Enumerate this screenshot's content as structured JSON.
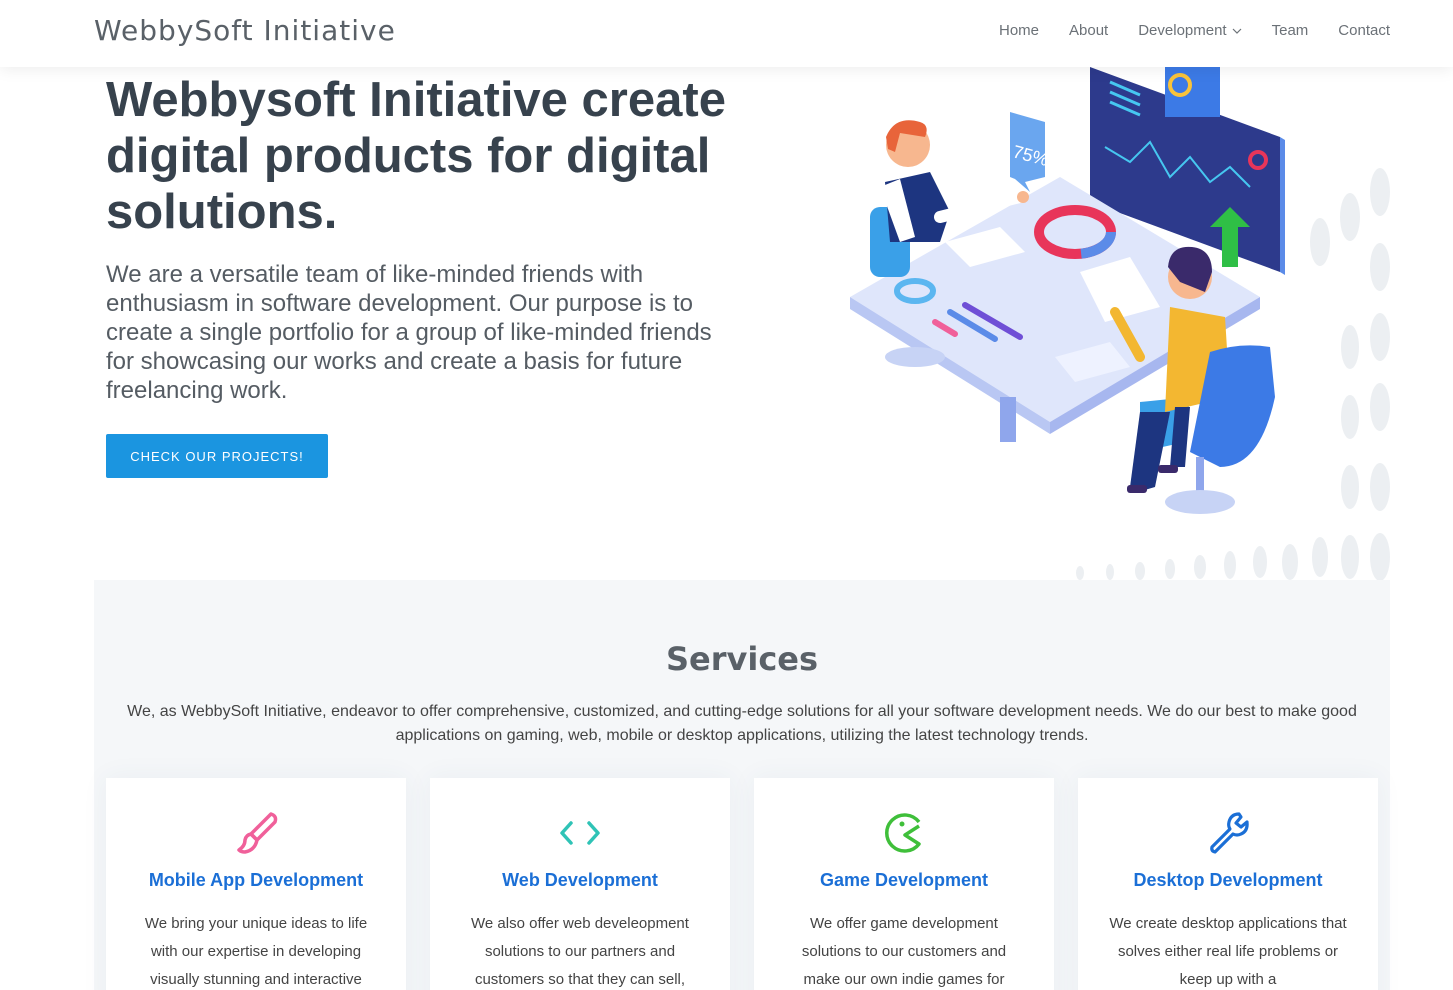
{
  "header": {
    "logo": "WebbySoft Initiative",
    "nav": [
      {
        "label": "Home"
      },
      {
        "label": "About"
      },
      {
        "label": "Development"
      },
      {
        "label": "Team"
      },
      {
        "label": "Contact"
      }
    ]
  },
  "hero": {
    "title": "Webbysoft Initiative create digital products for digital solutions.",
    "description": "We are a versatile team of like-minded friends with enthusiasm in software development. Our purpose is to create a single portfolio for a group of like-minded friends for showcasing our works and create a basis for future freelancing work.",
    "cta": "CHECK OUR PROJECTS!",
    "illustration_badge": "75%"
  },
  "services": {
    "title": "Services",
    "intro": "We, as WebbySoft Initiative, endeavor to offer comprehensive, customized, and cutting-edge solutions for all your software development needs. We do our best to make good applications on gaming, web, mobile or desktop applications, utilizing the latest technology trends.",
    "cards": [
      {
        "icon": "paintbrush-icon",
        "color": "#f0609a",
        "title": "Mobile App Development",
        "text": "We bring your unique ideas to life with our expertise in developing visually stunning and interactive"
      },
      {
        "icon": "code-icon",
        "color": "#2fc3b6",
        "title": "Web Development",
        "text": "We also offer web develeopment solutions to our partners and customers so that they can sell,"
      },
      {
        "icon": "pacman-icon",
        "color": "#3fbf3a",
        "title": "Game Development",
        "text": "We offer game development solutions to our customers and make our own indie games for"
      },
      {
        "icon": "wrench-icon",
        "color": "#1b6fd6",
        "title": "Desktop Development",
        "text": "We create desktop applications that solves either real life problems or keep up with a"
      }
    ]
  },
  "colors": {
    "accent": "#1b95e0",
    "card_title": "#1b6fd6"
  }
}
